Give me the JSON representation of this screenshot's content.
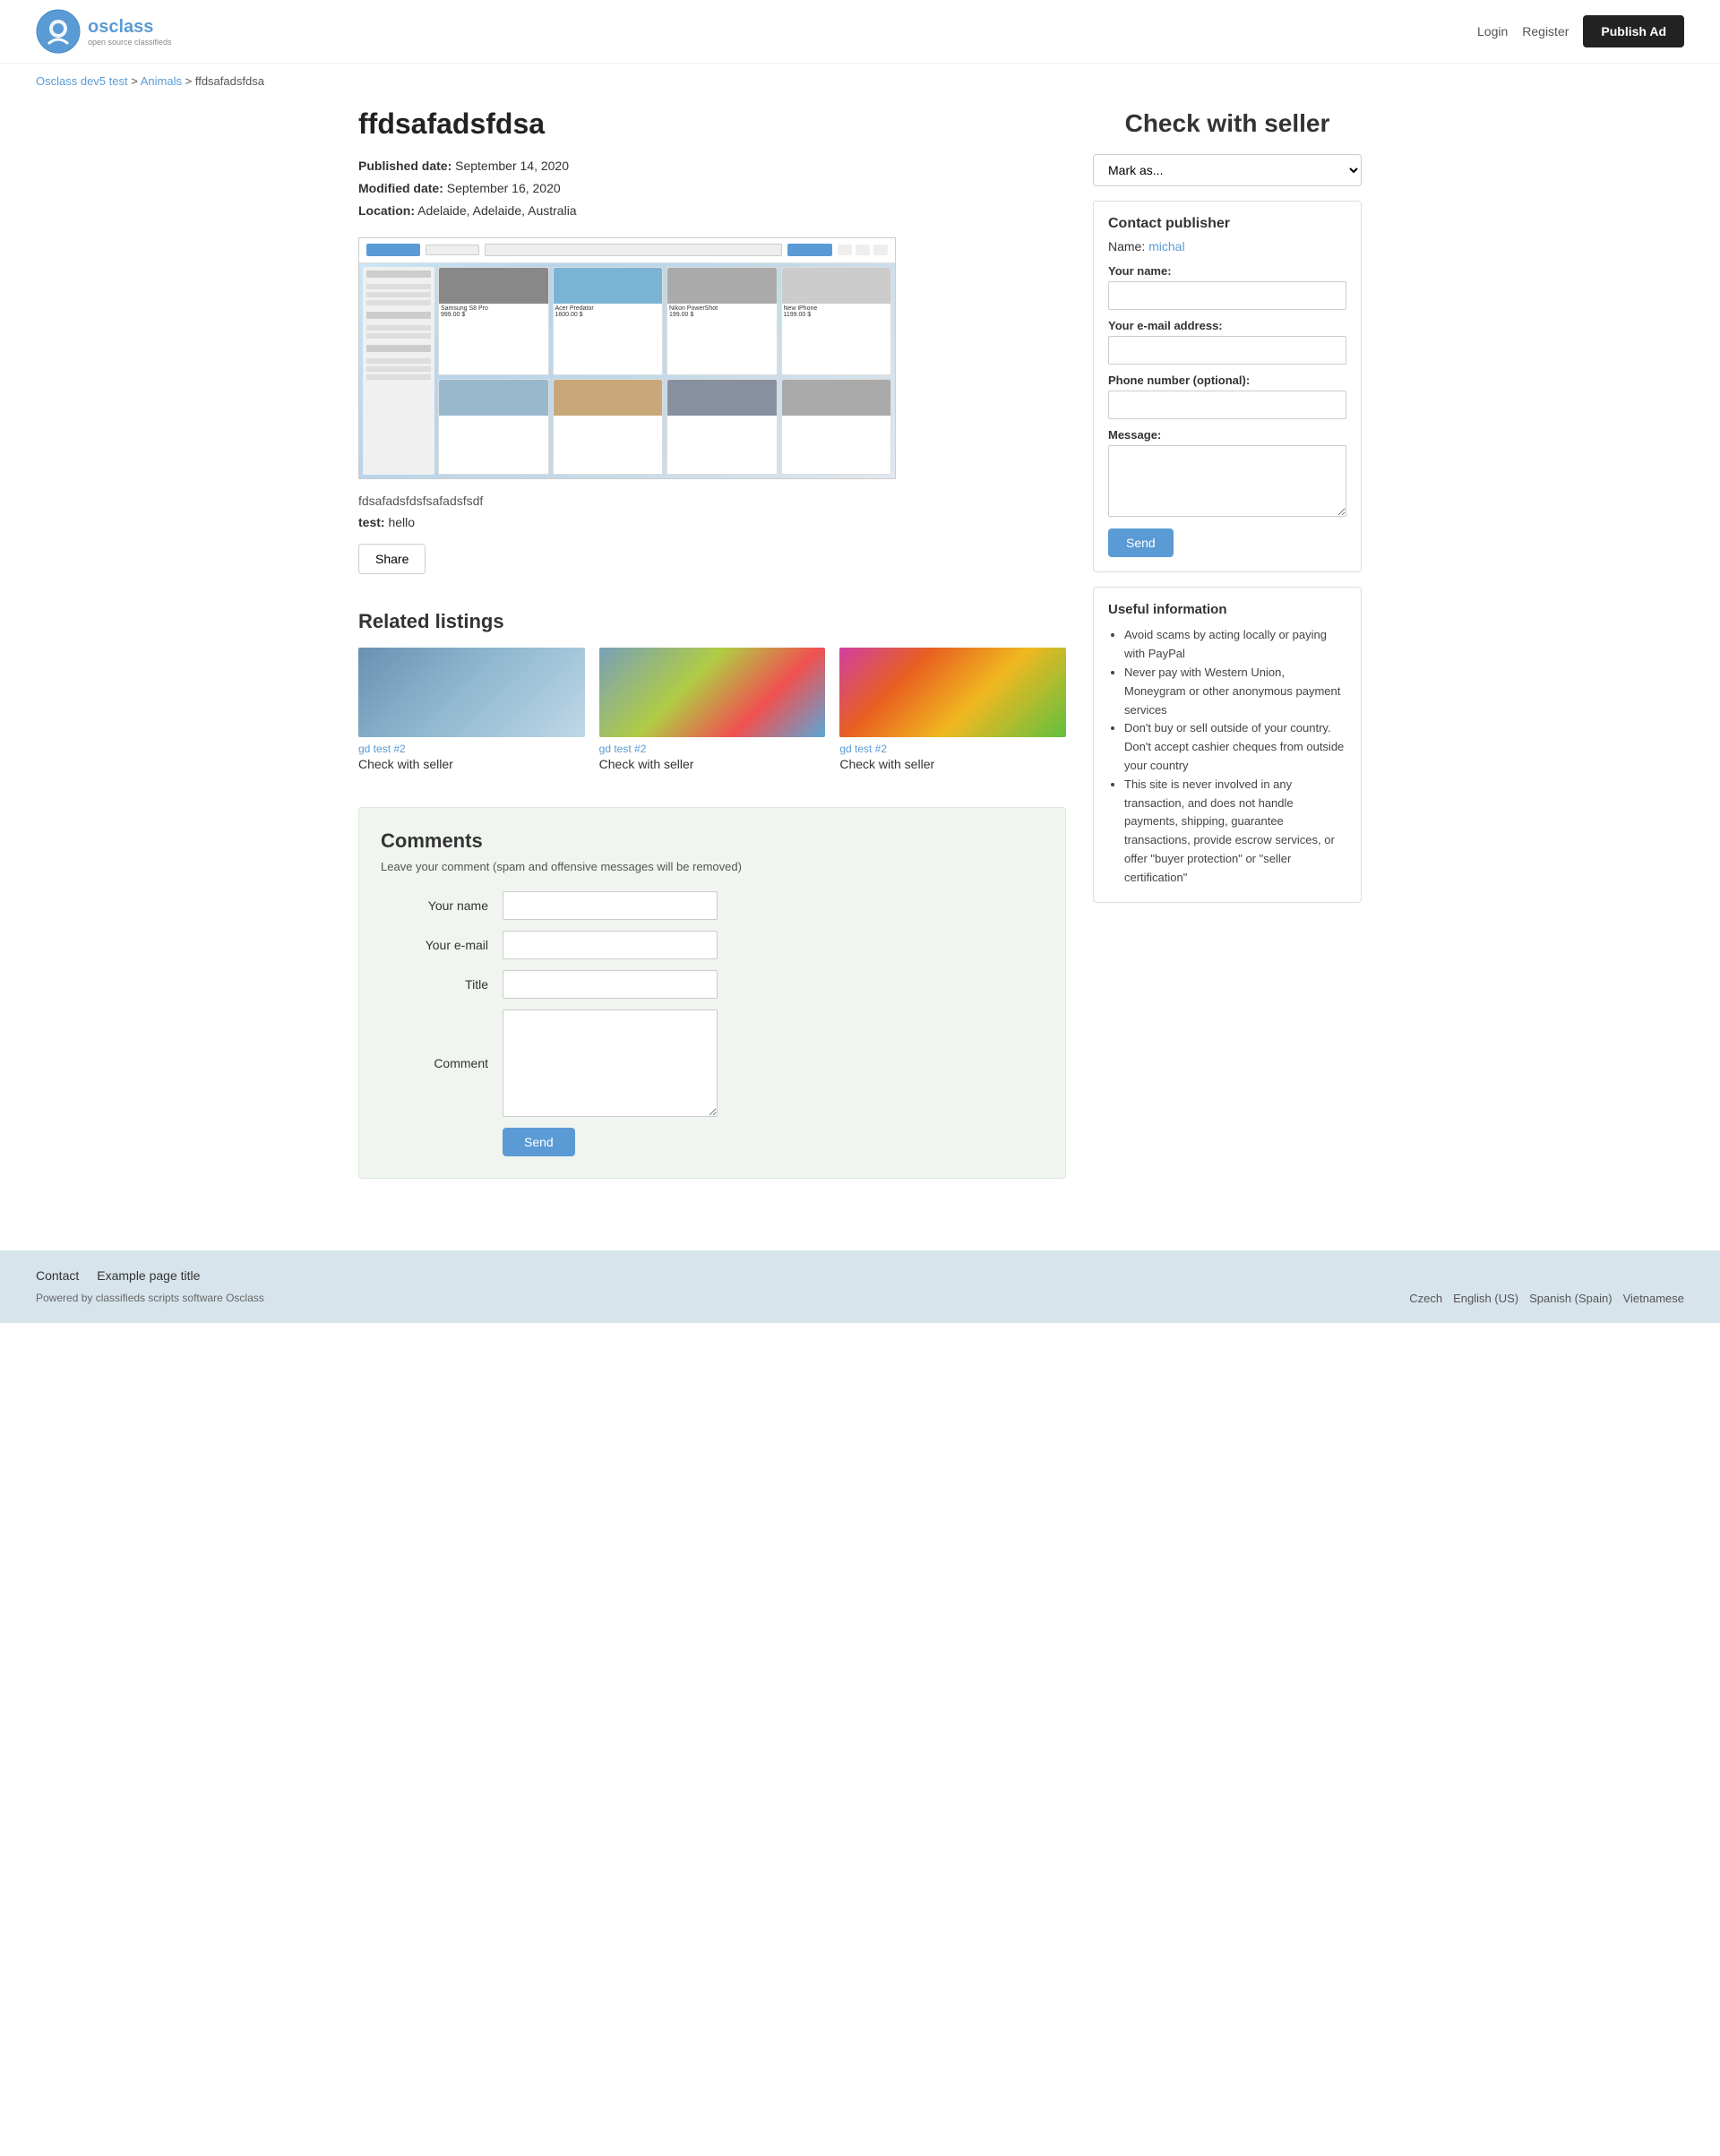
{
  "header": {
    "logo_alt": "Osclass open source classifieds",
    "nav": {
      "login": "Login",
      "register": "Register",
      "publish_ad": "Publish Ad"
    }
  },
  "breadcrumb": {
    "home": "Osclass dev5 test",
    "category": "Animals",
    "current": "ffdsafadsfdsa"
  },
  "listing": {
    "title": "ffdsafadsfdsa",
    "published_label": "Published date:",
    "published_date": "September 14, 2020",
    "modified_label": "Modified date:",
    "modified_date": "September 16, 2020",
    "location_label": "Location:",
    "location": "Adelaide, Adelaide, Australia",
    "description": "fdsafadsfdsfsafadsfsdf",
    "test_label": "test:",
    "test_value": "hello",
    "share_button": "Share"
  },
  "related_listings": {
    "title": "Related listings",
    "items": [
      {
        "category": "gd test #2",
        "title": "Check with seller"
      },
      {
        "category": "gd test #2",
        "title": "Check with seller"
      },
      {
        "category": "gd test #2",
        "title": "Check with seller"
      }
    ]
  },
  "comments": {
    "title": "Comments",
    "note": "Leave your comment (spam and offensive messages will be removed)",
    "fields": {
      "your_name_label": "Your name",
      "your_email_label": "Your e-mail",
      "title_label": "Title",
      "comment_label": "Comment"
    },
    "send_button": "Send"
  },
  "right_panel": {
    "check_with_seller": "Check with seller",
    "mark_as": "Mark as...",
    "contact_publisher": {
      "title": "Contact publisher",
      "name_label": "Name:",
      "name_value": "michal",
      "your_name_label": "Your name:",
      "your_email_label": "Your e-mail address:",
      "phone_label": "Phone number (optional):",
      "message_label": "Message:",
      "send_button": "Send"
    },
    "useful_info": {
      "title": "Useful information",
      "items": [
        "Avoid scams by acting locally or paying with PayPal",
        "Never pay with Western Union, Moneygram or other anonymous payment services",
        "Don't buy or sell outside of your country. Don't accept cashier cheques from outside your country",
        "This site is never involved in any transaction, and does not handle payments, shipping, guarantee transactions, provide escrow services, or offer \"buyer protection\" or \"seller certification\""
      ]
    }
  },
  "footer": {
    "links": [
      {
        "label": "Contact",
        "href": "#"
      },
      {
        "label": "Example page title",
        "href": "#"
      }
    ],
    "powered_by": "Powered by classifieds scripts software Osclass",
    "languages": [
      {
        "label": "Czech",
        "href": "#"
      },
      {
        "label": "English (US)",
        "href": "#"
      },
      {
        "label": "Spanish (Spain)",
        "href": "#"
      },
      {
        "label": "Vietnamese",
        "href": "#"
      }
    ]
  }
}
